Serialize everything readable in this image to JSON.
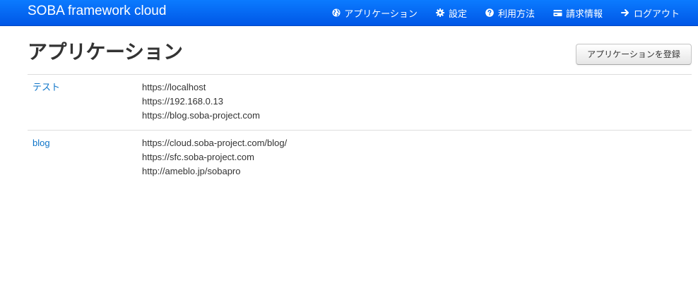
{
  "navbar": {
    "brand": "SOBA framework cloud",
    "items": [
      {
        "label": "アプリケーション",
        "icon": "globe-icon"
      },
      {
        "label": "設定",
        "icon": "gear-icon"
      },
      {
        "label": "利用方法",
        "icon": "question-icon"
      },
      {
        "label": "請求情報",
        "icon": "credit-card-icon"
      },
      {
        "label": "ログアウト",
        "icon": "arrow-right-icon"
      }
    ]
  },
  "page": {
    "title": "アプリケーション",
    "register_label": "アプリケーションを登録"
  },
  "applications": [
    {
      "name": "テスト",
      "urls": [
        "https://localhost",
        "https://192.168.0.13",
        "https://blog.soba-project.com"
      ]
    },
    {
      "name": "blog",
      "urls": [
        "https://cloud.soba-project.com/blog/",
        "https://sfc.soba-project.com",
        "http://ameblo.jp/sobapro"
      ]
    }
  ],
  "colors": {
    "navbar": "#0b7bff",
    "link": "#0e74c8"
  }
}
